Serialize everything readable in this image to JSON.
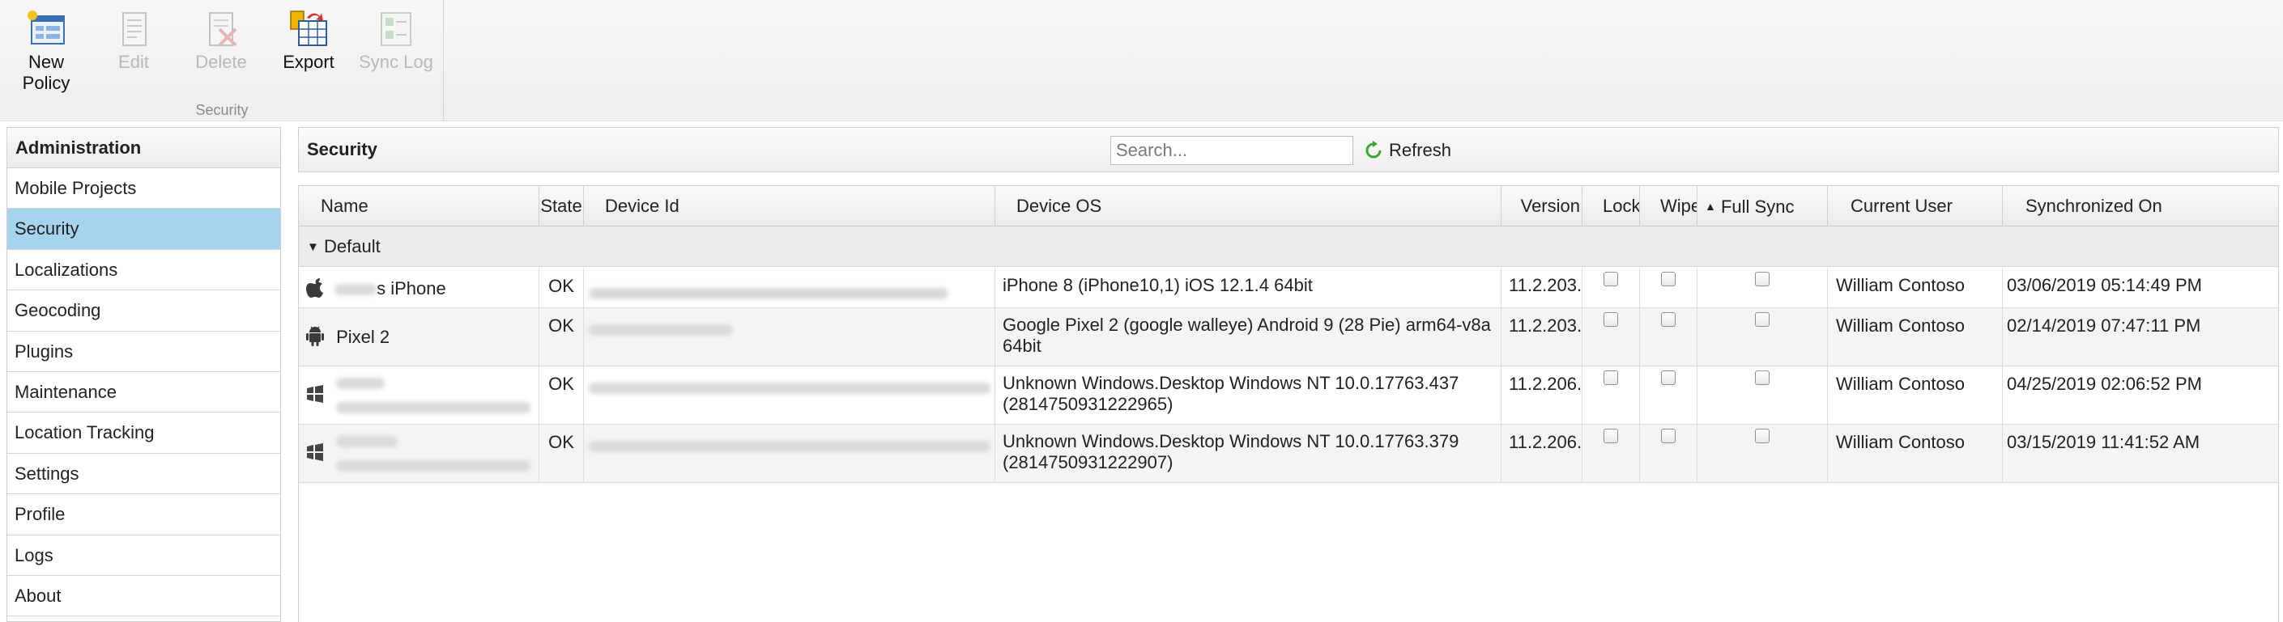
{
  "ribbon": {
    "buttons": [
      {
        "label_line1": "New",
        "label_line2": "Policy",
        "enabled": true,
        "icon": "new-policy-icon"
      },
      {
        "label_line1": "Edit",
        "enabled": false,
        "icon": "edit-icon"
      },
      {
        "label_line1": "Delete",
        "enabled": false,
        "icon": "delete-icon"
      },
      {
        "label_line1": "Export",
        "enabled": true,
        "icon": "export-icon"
      },
      {
        "label_line1": "Sync Log",
        "enabled": false,
        "icon": "sync-log-icon"
      }
    ],
    "group_label": "Security"
  },
  "sidebar": {
    "header": "Administration",
    "items": [
      {
        "label": "Mobile Projects"
      },
      {
        "label": "Security",
        "selected": true
      },
      {
        "label": "Localizations"
      },
      {
        "label": "Geocoding"
      },
      {
        "label": "Plugins"
      },
      {
        "label": "Maintenance"
      },
      {
        "label": "Location Tracking"
      },
      {
        "label": "Settings"
      },
      {
        "label": "Profile"
      },
      {
        "label": "Logs"
      },
      {
        "label": "About"
      }
    ]
  },
  "panel": {
    "title": "Security",
    "search_placeholder": "Search...",
    "refresh_label": "Refresh"
  },
  "table": {
    "columns": [
      "Name",
      "State",
      "Device Id",
      "Device OS",
      "Version",
      "Lock",
      "Wipe",
      "Full Sync",
      "Current User",
      "Synchronized On"
    ],
    "sorted_column": "Full Sync",
    "group_label": "Default",
    "rows": [
      {
        "icon": "apple-icon",
        "name": "s iPhone",
        "state": "OK",
        "os_line1": "iPhone 8 (iPhone10,1) iOS 12.1.4 64bit",
        "os_line2": "",
        "version": "11.2.203.",
        "user": "William Contoso",
        "synced": "03/06/2019 05:14:49 PM"
      },
      {
        "icon": "android-icon",
        "name": "Pixel 2",
        "state": "OK",
        "os_line1": "Google Pixel 2 (google walleye) Android 9 (28 Pie) arm64-v8a",
        "os_line2": "64bit",
        "version": "11.2.203.",
        "user": "William Contoso",
        "synced": "02/14/2019 07:47:11 PM"
      },
      {
        "icon": "windows-icon",
        "name": "",
        "state": "OK",
        "os_line1": "Unknown Windows.Desktop Windows NT 10.0.17763.437",
        "os_line2": "(2814750931222965)",
        "version": "11.2.206.",
        "user": "William Contoso",
        "synced": "04/25/2019 02:06:52 PM"
      },
      {
        "icon": "windows-icon",
        "name": "",
        "state": "OK",
        "os_line1": "Unknown Windows.Desktop Windows NT 10.0.17763.379",
        "os_line2": "(2814750931222907)",
        "version": "11.2.206.",
        "user": "William Contoso",
        "synced": "03/15/2019 11:41:52 AM"
      }
    ]
  },
  "colors": {
    "selected_nav": "#a6d3ee",
    "refresh_icon": "#3aa832"
  }
}
